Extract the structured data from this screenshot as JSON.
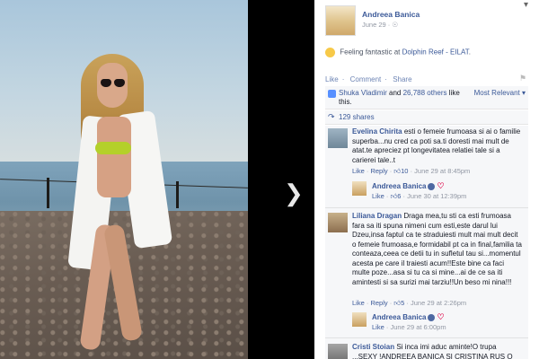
{
  "post": {
    "author": "Andreea Banica",
    "date": "June 29",
    "feeling_prefix": "Feeling fantastic at ",
    "place": "Dolphin Reef - EILAT",
    "feeling_suffix": "."
  },
  "actions": {
    "like": "Like",
    "comment": "Comment",
    "share": "Share",
    "sep": "·"
  },
  "likes": {
    "names": "Shuka Vladimir",
    "and": " and ",
    "others": "26,788 others",
    "suffix": " like this.",
    "sort": "Most Relevant ▾"
  },
  "shares": {
    "label": "129 shares"
  },
  "comments": [
    {
      "name": "Evelina Chirita",
      "text": "esti o femeie frumoasa si ai o familie superba...nu cred ca poti sa.ti doresti mai mult de atat.te apreciez pt longevitatea relatiei tale si a carierei tale..t",
      "like": "Like",
      "reply": "Reply",
      "likes": "10",
      "time": "June 29 at 8:45pm",
      "reply_item": {
        "name": "Andreea Banica",
        "like": "Like",
        "likes": "6",
        "time": "June 30 at 12:39pm"
      }
    },
    {
      "name": "Liliana Dragan",
      "text": "Draga mea,tu sti ca esti frumoasa fara sa iti spuna nimeni cum esti,este darul lui Dzeu,insa faptul ca te straduiesti mult mai mult decit o femeie frumoasa,e formidabil pt ca in final,familia ta conteaza,ceea ce detii tu in sufletul tau si...momentul acesta pe care il traiesti acum!!Este bine ca faci multe poze...asa si tu ca si mine...ai de ce sa iti amintesti si sa surizi mai tarziu!!Un beso mi nina!!!",
      "like": "Like",
      "reply": "Reply",
      "likes": "5",
      "time": "June 29 at 2:26pm",
      "reply_item": {
        "name": "Andreea Banica",
        "like": "Like",
        "likes": "",
        "time": "June 29 at 6:00pm"
      }
    },
    {
      "name": "Cristi Stoian",
      "text": "Si inca imi aduc aminte!O trupa ...SEXY !ANDREEA BANICA SI CRISTINA RUS O"
    }
  ],
  "colors": {
    "link": "#3b5998",
    "muted": "#9197a3",
    "bikini": "#b4d02a"
  }
}
